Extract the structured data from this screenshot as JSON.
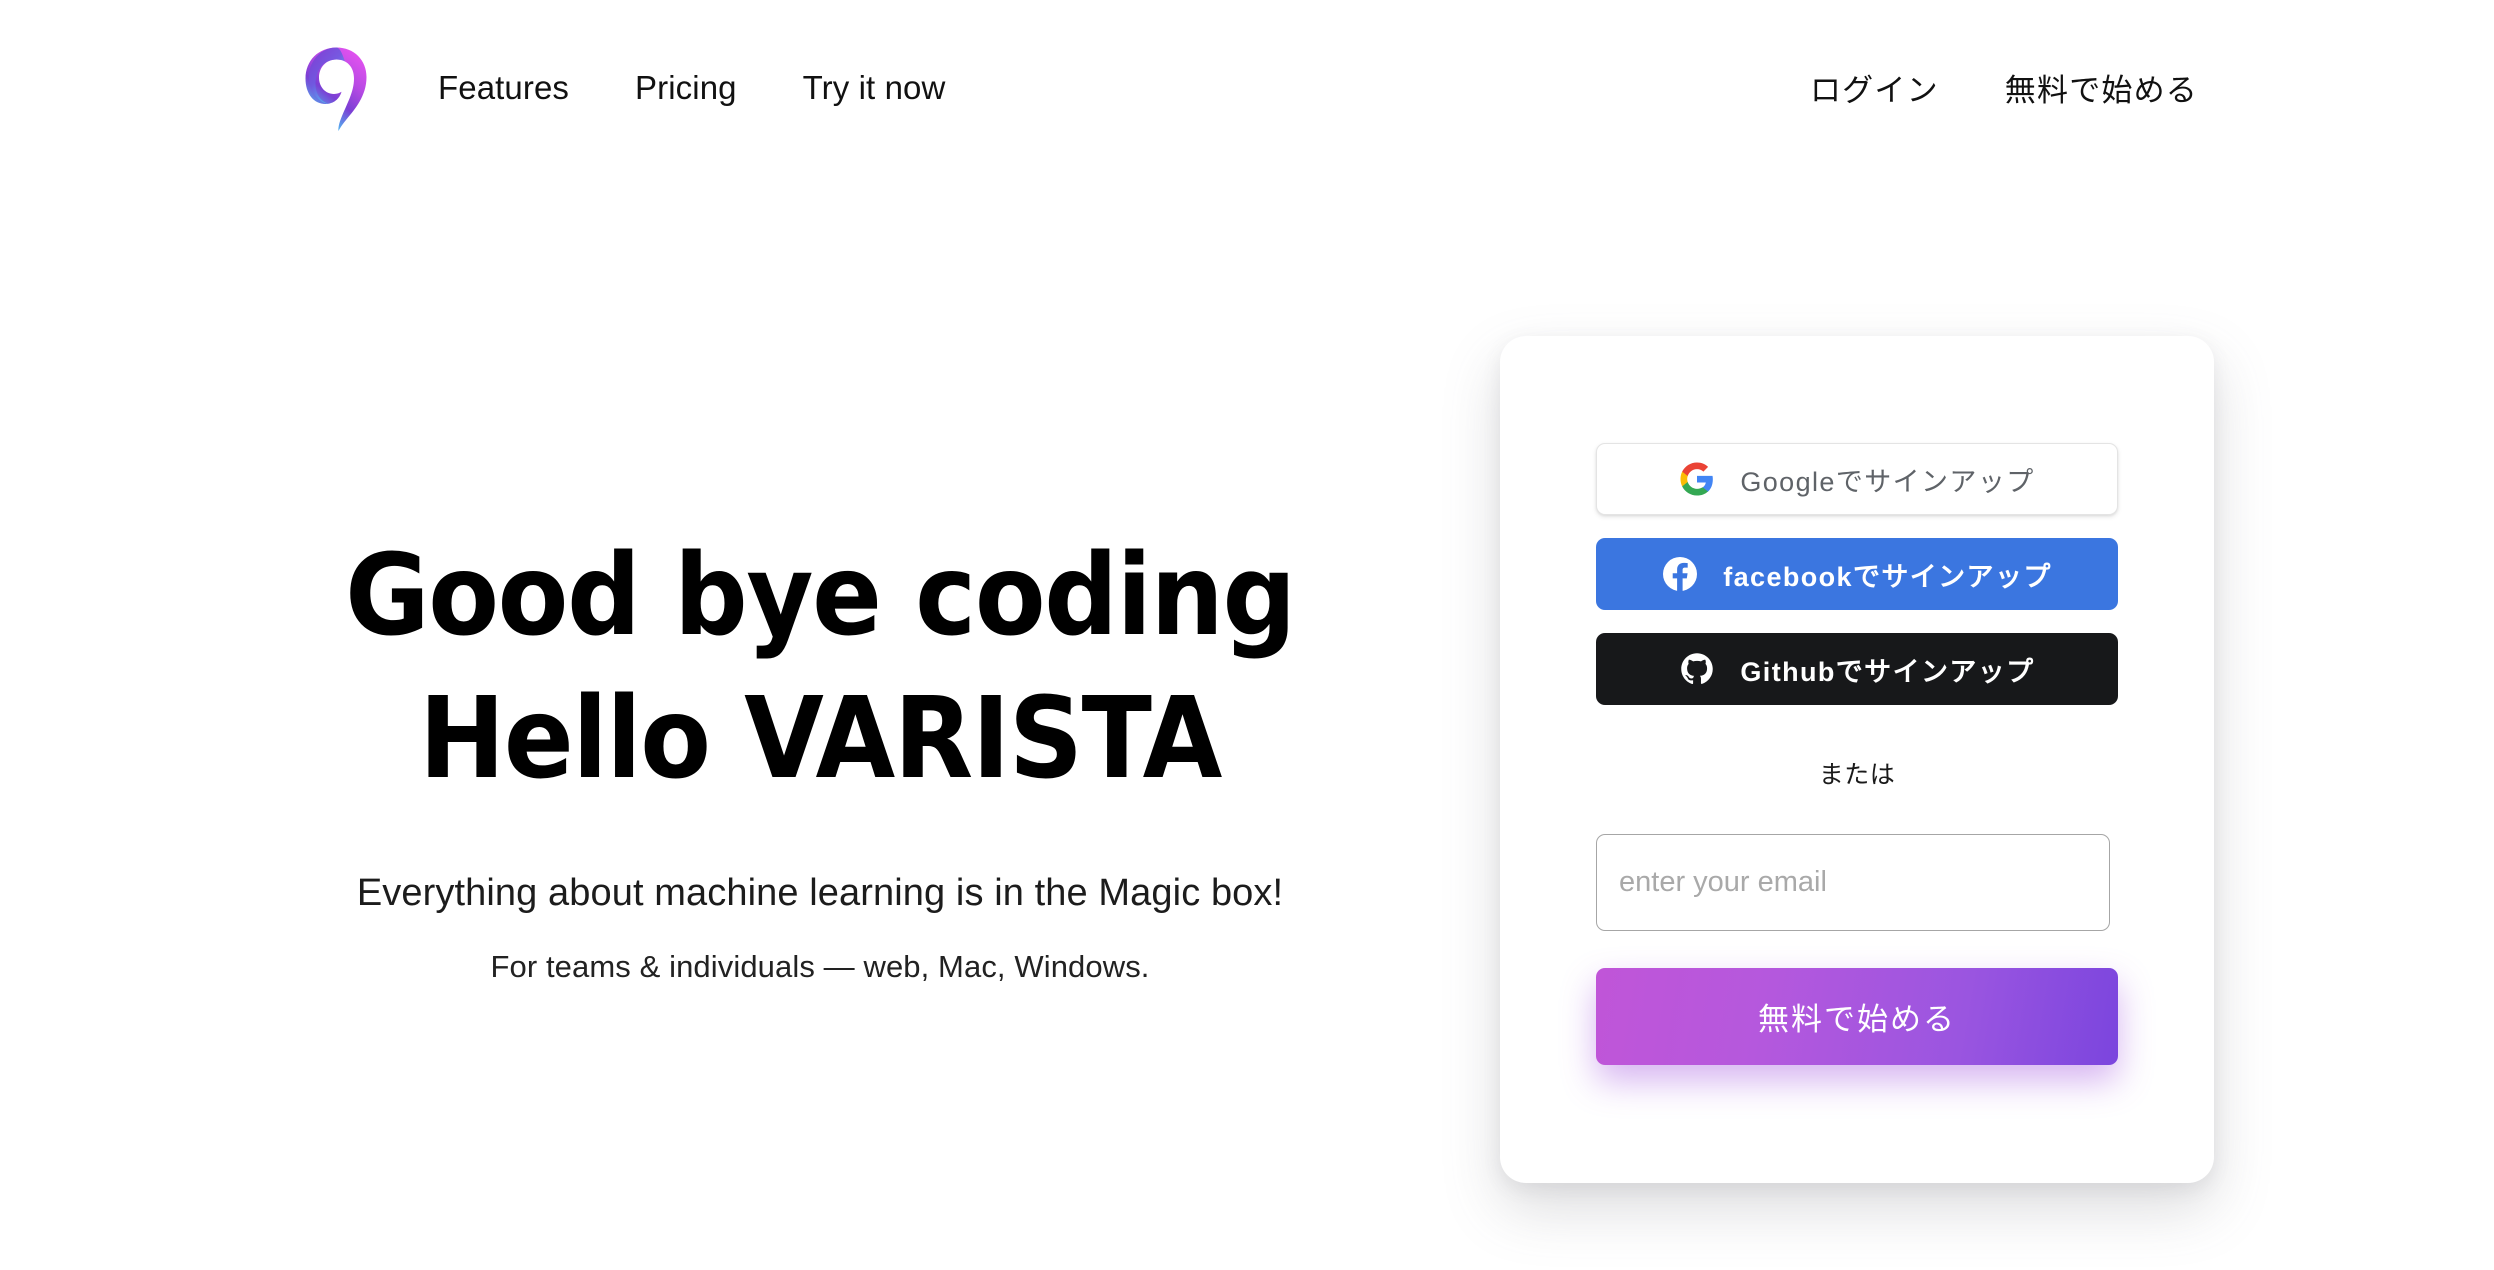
{
  "brand": {
    "logo_icon": "varista-comma-logo",
    "gradient_from": "#d04ce8",
    "gradient_mid": "#7b3fd4",
    "gradient_to": "#4ec8f5"
  },
  "header": {
    "nav_left": [
      {
        "label": "Features",
        "name": "nav-link-features"
      },
      {
        "label": "Pricing",
        "name": "nav-link-pricing"
      },
      {
        "label": "Try it now",
        "name": "nav-link-try-it-now"
      }
    ],
    "nav_right": [
      {
        "label": "ログイン",
        "name": "nav-link-login"
      },
      {
        "label": "無料で始める",
        "name": "nav-link-start-free"
      }
    ]
  },
  "hero": {
    "title_line1": "Good bye coding",
    "title_line2": "Hello VARISTA",
    "subtitle": "Everything about machine learning is in the Magic box!",
    "subtitle2": "For teams & individuals — web, Mac, Windows."
  },
  "signup": {
    "google_label": "Googleでサインアップ",
    "facebook_label": "facebookでサインアップ",
    "github_label": "Githubでサインアップ",
    "divider_label": "または",
    "email_placeholder": "enter your email",
    "email_value": "",
    "cta_label": "無料で始める",
    "colors": {
      "facebook_blue": "#3b76e0",
      "github_black": "#17181a",
      "cta_gradient_from": "#c055d8",
      "cta_gradient_to": "#7b45de"
    }
  }
}
